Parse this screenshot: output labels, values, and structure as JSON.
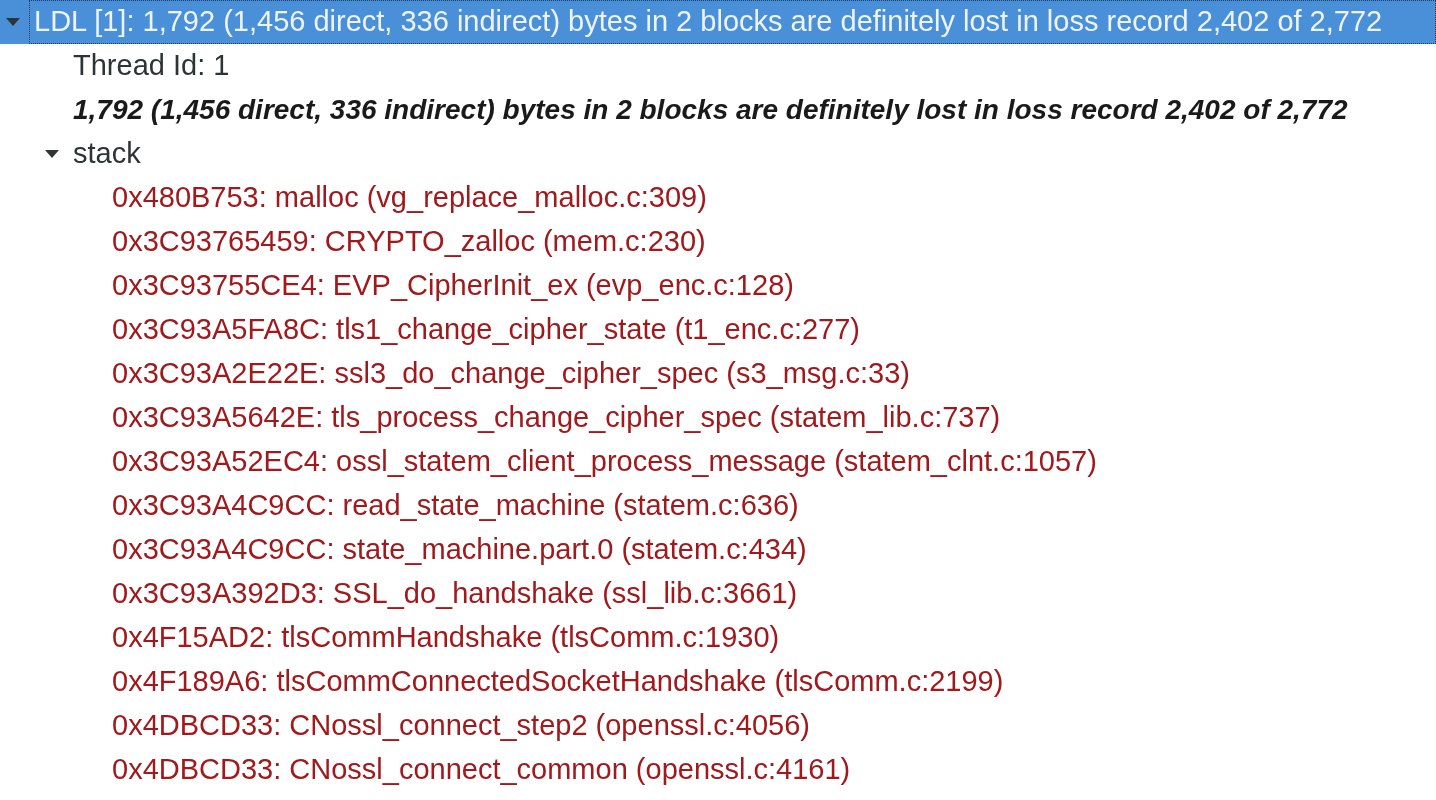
{
  "tree": [
    {
      "kind": "group",
      "label": "LDL [1]: 1,792 (1,456 direct, 336 indirect) bytes in 2 blocks are definitely lost in loss record 2,402 of 2,772",
      "selected": true,
      "expanded": true,
      "children": [
        {
          "kind": "text",
          "label": "Thread Id: 1",
          "selected": false
        },
        {
          "kind": "emphasis",
          "label": "1,792 (1,456 direct, 336 indirect) bytes in 2 blocks are definitely lost in loss record 2,402 of 2,772",
          "selected": false
        },
        {
          "kind": "group",
          "label": "stack",
          "selected": false,
          "expanded": true,
          "children": [
            {
              "kind": "frame",
              "label": "0x480B753: malloc (vg_replace_malloc.c:309)",
              "selected": false
            },
            {
              "kind": "frame",
              "label": "0x3C93765459: CRYPTO_zalloc (mem.c:230)",
              "selected": false
            },
            {
              "kind": "frame",
              "label": "0x3C93755CE4: EVP_CipherInit_ex (evp_enc.c:128)",
              "selected": false
            },
            {
              "kind": "frame",
              "label": "0x3C93A5FA8C: tls1_change_cipher_state (t1_enc.c:277)",
              "selected": false
            },
            {
              "kind": "frame",
              "label": "0x3C93A2E22E: ssl3_do_change_cipher_spec (s3_msg.c:33)",
              "selected": false
            },
            {
              "kind": "frame",
              "label": "0x3C93A5642E: tls_process_change_cipher_spec (statem_lib.c:737)",
              "selected": false
            },
            {
              "kind": "frame",
              "label": "0x3C93A52EC4: ossl_statem_client_process_message (statem_clnt.c:1057)",
              "selected": false
            },
            {
              "kind": "frame",
              "label": "0x3C93A4C9CC: read_state_machine (statem.c:636)",
              "selected": false
            },
            {
              "kind": "frame",
              "label": "0x3C93A4C9CC: state_machine.part.0 (statem.c:434)",
              "selected": false
            },
            {
              "kind": "frame",
              "label": "0x3C93A392D3: SSL_do_handshake (ssl_lib.c:3661)",
              "selected": false
            },
            {
              "kind": "frame",
              "label": "0x4F15AD2: tlsCommHandshake (tlsComm.c:1930)",
              "selected": false
            },
            {
              "kind": "frame",
              "label": "0x4F189A6: tlsCommConnectedSocketHandshake (tlsComm.c:2199)",
              "selected": false
            },
            {
              "kind": "frame",
              "label": "0x4DBCD33: CNossl_connect_step2 (openssl.c:4056)",
              "selected": false
            },
            {
              "kind": "frame",
              "label": "0x4DBCD33: CNossl_connect_common (openssl.c:4161)",
              "selected": false
            }
          ]
        }
      ]
    }
  ]
}
